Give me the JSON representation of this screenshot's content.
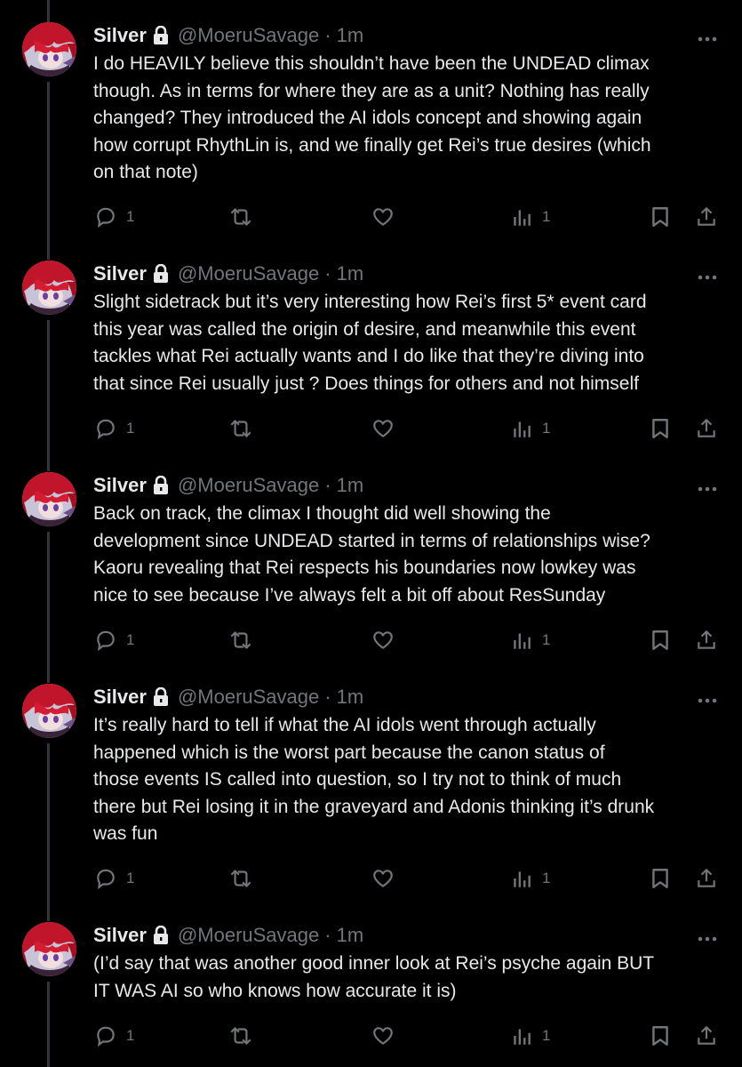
{
  "tweets": [
    {
      "name": "Silver",
      "handle": "@MoeruSavage",
      "separator": "·",
      "time": "1m",
      "text": "I do HEAVILY believe this shouldn’t have been the UNDEAD climax\nthough. As in terms for where they are as a unit? Nothing has really\nchanged? They introduced the AI idols concept and showing again\nhow corrupt RhythLin is, and we finally get Rei’s true desires (which\non that note)",
      "replies": "1",
      "retweets": "",
      "likes": "",
      "views": "1"
    },
    {
      "name": "Silver",
      "handle": "@MoeruSavage",
      "separator": "·",
      "time": "1m",
      "text": "Slight sidetrack but it’s very interesting how Rei’s first 5* event card\nthis year was called the origin of desire, and meanwhile this event\ntackles what Rei actually wants and I do like that they’re diving into\nthat since Rei usually just ? Does things for others and not himself",
      "replies": "1",
      "retweets": "",
      "likes": "",
      "views": "1"
    },
    {
      "name": "Silver",
      "handle": "@MoeruSavage",
      "separator": "·",
      "time": "1m",
      "text": "Back on track, the climax I thought did well showing the\ndevelopment since UNDEAD started in terms of relationships wise?\nKaoru revealing that Rei respects his boundaries now lowkey was\nnice to see because I’ve always felt a bit off about ResSunday",
      "replies": "1",
      "retweets": "",
      "likes": "",
      "views": "1"
    },
    {
      "name": "Silver",
      "handle": "@MoeruSavage",
      "separator": "·",
      "time": "1m",
      "text": "It’s really hard to tell if what the AI idols went through actually\nhappened which is the worst part because the canon status of\nthose events IS called into question, so I try not to think of much\nthere but Rei losing it in the graveyard and Adonis thinking it’s drunk\nwas fun",
      "replies": "1",
      "retweets": "",
      "likes": "",
      "views": "1"
    },
    {
      "name": "Silver",
      "handle": "@MoeruSavage",
      "separator": "·",
      "time": "1m",
      "text": "(I’d say that was another good inner look at Rei’s psyche again BUT\nIT WAS AI so who knows how accurate it is)",
      "replies": "1",
      "retweets": "",
      "likes": "",
      "views": "1"
    }
  ],
  "colors": {
    "background": "#000000",
    "text": "#e7e9ea",
    "muted": "#71767b",
    "thread_line": "#333639"
  }
}
